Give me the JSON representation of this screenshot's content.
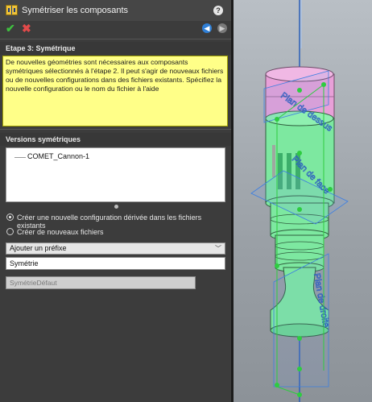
{
  "panel": {
    "title": "Symétriser les composants",
    "help_icon": "?",
    "ok_icon": "checkmark-icon",
    "cancel_icon": "close-icon",
    "back_icon": "back-arrow-icon",
    "forward_icon": "forward-arrow-icon"
  },
  "step": {
    "header": "Etape 3: Symétrique",
    "message": "De nouvelles géométries sont nécessaires aux composants symétriques sélectionnés à l'étape 2. Il peut s'agir de nouveaux fichiers ou de nouvelles configurations dans des fichiers existants. Spécifiez la nouvelle configuration ou le nom du fichier à l'aide"
  },
  "versions": {
    "header": "Versions symétriques",
    "items": [
      "COMET_Cannon-1"
    ]
  },
  "options": {
    "radio_config": "Créer une nouvelle configuration dérivée dans les fichiers existants",
    "radio_config_selected": true,
    "radio_files": "Créer de nouveaux fichiers",
    "radio_files_selected": false,
    "prefix_select": "Ajouter un préfixe",
    "name_value": "Symétrie",
    "default_placeholder": "SymétrieDéfaut"
  },
  "viewport": {
    "plane_labels": [
      "Plan de dessus",
      "Plan de face",
      "Plan de droite"
    ],
    "colors": {
      "pink_part": "#e8a0d8",
      "green_part": "#7de8a0",
      "plane_blue": "#3d7fe0",
      "handle_green": "#2ecc40"
    }
  }
}
